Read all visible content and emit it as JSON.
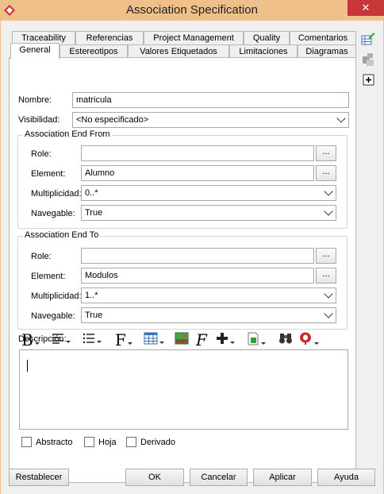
{
  "window": {
    "title": "Association Specification",
    "close_label": "✕"
  },
  "tabs_row1": [
    "Traceability",
    "Referencias",
    "Project Management",
    "Quality",
    "Comentarios"
  ],
  "tabs_row2": [
    "General",
    "Estereotipos",
    "Valores Etiquetados",
    "Limitaciones",
    "Diagramas"
  ],
  "active_tab": "General",
  "form": {
    "nombre_label": "Nombre:",
    "nombre_value": "matricula",
    "visibilidad_label": "Visibilidad:",
    "visibilidad_value": "<No especificado>"
  },
  "end_from": {
    "title": "Association End From",
    "role_label": "Role:",
    "role_value": "",
    "element_label": "Element:",
    "element_value": "Alumno",
    "mult_label": "Multiplicidad:",
    "mult_value": "0..*",
    "nav_label": "Navegable:",
    "nav_value": "True",
    "browse_label": "..."
  },
  "end_to": {
    "title": "Association End To",
    "role_label": "Role:",
    "role_value": "",
    "element_label": "Element:",
    "element_value": "Modulos",
    "mult_label": "Multiplicidad:",
    "mult_value": "1..*",
    "nav_label": "Navegable:",
    "nav_value": "True",
    "browse_label": "..."
  },
  "descripcion": {
    "label": "Descripción:",
    "toolbar": [
      "bold-icon",
      "align-icon",
      "list-icon",
      "font-icon",
      "table-icon",
      "image-icon",
      "function-icon",
      "insert-icon",
      "document-icon",
      "binoculars-icon",
      "spellcheck-icon"
    ],
    "bold_glyph": "B",
    "font_glyph": "F",
    "func_glyph": "F",
    "text": ""
  },
  "checkboxes": {
    "abstracto": "Abstracto",
    "hoja": "Hoja",
    "derivado": "Derivado"
  },
  "buttons": {
    "restablecer": "Restablecer",
    "ok": "OK",
    "cancelar": "Cancelar",
    "aplicar": "Aplicar",
    "ayuda": "Ayuda"
  },
  "colors": {
    "titlebar": "#f0c08a",
    "close": "#c7373a",
    "panel": "#ffffff",
    "background": "#f0f0f0"
  }
}
